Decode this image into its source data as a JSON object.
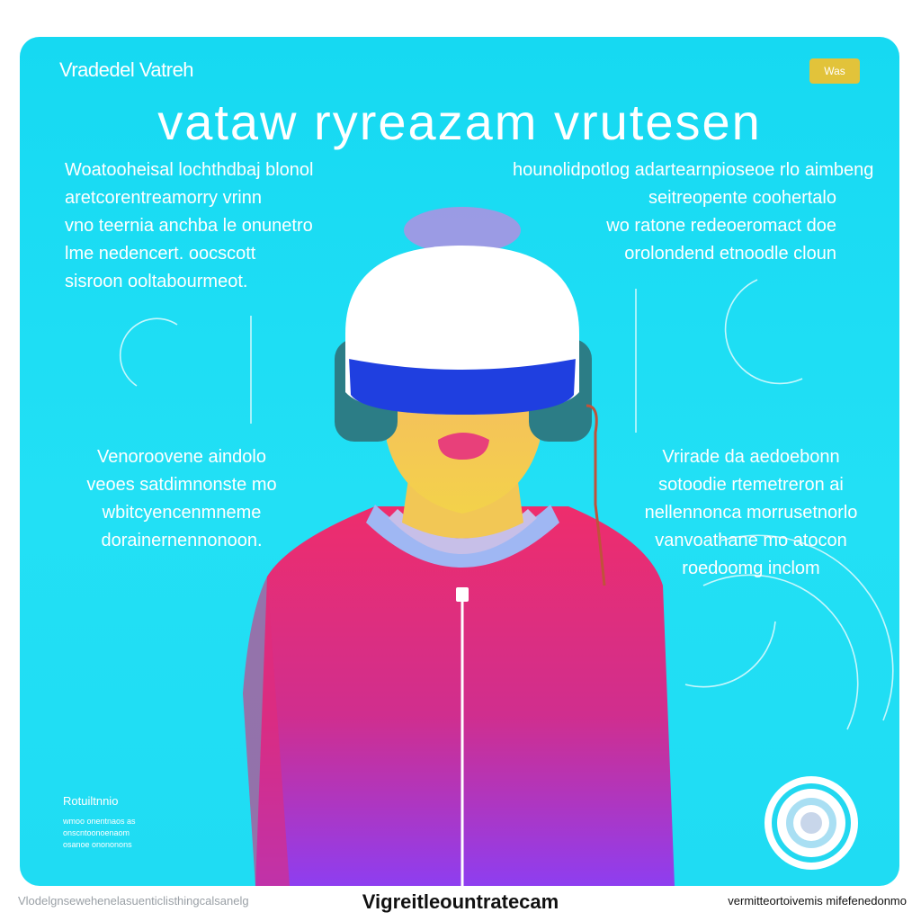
{
  "brand": "Vradedel Vatreh",
  "badge": "Was",
  "headline": "vataw ryreazam vrutesen",
  "left_top": [
    "Woatooheisal lochthdbaj blonol",
    "aretcorentreamorry vrinn",
    "vno teernia anchba le onunetro",
    "lme nedencert. oocscott",
    "sisroon ooltabourmeot."
  ],
  "right_top": [
    "hounolidpotlog adartearnpioseoe rlo aimbeng",
    "seitreopente coohertalo",
    "wo ratone redeoeromact doe",
    "orolondend etnoodle cloun"
  ],
  "left_mid": [
    "Venoroovene aindolo",
    "veoes satdimnonste mo",
    "wbitcyencenmneme",
    "dorainernennonoon."
  ],
  "right_mid": [
    "Vrirade da aedoebonn",
    "sotoodie rtemetreron ai",
    "nellennonca morrusetnorlo",
    "vanvoathane mo atocon",
    "roedoomg inclom"
  ],
  "fine_title": "Rotuiltnnio",
  "fine_lines": [
    "wmoo onentnaos as",
    "onscntoonoenaom",
    "osanoe onononons"
  ],
  "footer": {
    "left": "Vlodelgnsewehenelasuenticlisthingcalsanelg",
    "center": "Vigreitleountratecam",
    "right": "vermitteortoivemis mifefenedonmo"
  },
  "colors": {
    "card": "#1fdcf3",
    "jacket_top": "#ee2d6c",
    "jacket_bottom": "#8e3ef0",
    "headset_band": "#1f3fe0",
    "headset_shell": "#ffffff",
    "skin": "#f3c85a",
    "badge": "#e2c33a"
  },
  "icons": [
    "vr-headset-figure",
    "target-rings-icon"
  ]
}
